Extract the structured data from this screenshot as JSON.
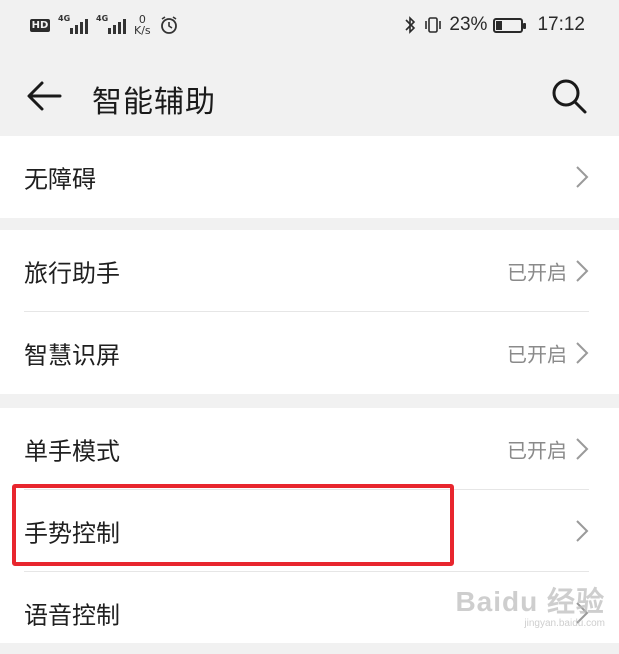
{
  "status_bar": {
    "net_tag_1": "4G",
    "net_tag_2": "4G",
    "speed_value": "0",
    "speed_unit": "K/s",
    "battery_text": "23%",
    "battery_level": 0.23,
    "time": "17:12"
  },
  "header": {
    "title": "智能辅助"
  },
  "sections": [
    {
      "items": [
        {
          "label": "无障碍",
          "status": ""
        }
      ]
    },
    {
      "items": [
        {
          "label": "旅行助手",
          "status": "已开启"
        },
        {
          "label": "智慧识屏",
          "status": "已开启"
        }
      ]
    },
    {
      "items": [
        {
          "label": "单手模式",
          "status": "已开启"
        },
        {
          "label": "手势控制",
          "status": ""
        },
        {
          "label": "语音控制",
          "status": ""
        }
      ]
    }
  ],
  "watermark": {
    "brand": "Baidu 经验",
    "site": "jingyan.baidu.com"
  },
  "colors": {
    "highlight": "#e8262e",
    "background": "#f1f1f1",
    "card": "#ffffff"
  }
}
